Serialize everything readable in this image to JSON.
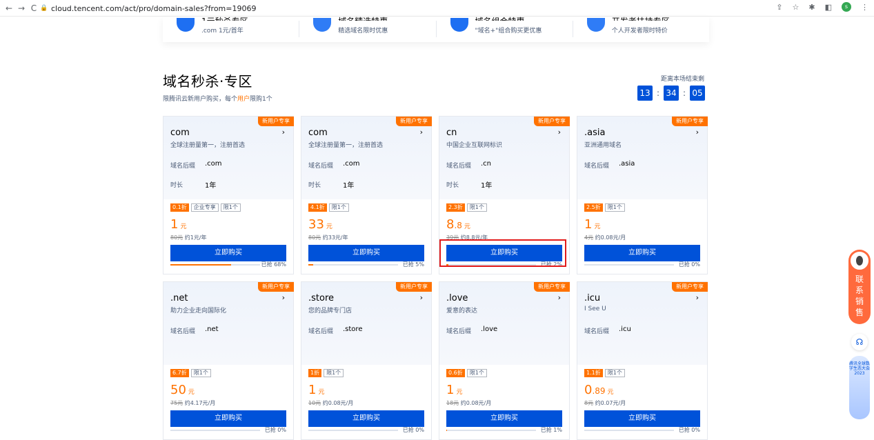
{
  "browser": {
    "url": "cloud.tencent.com/act/pro/domain-sales?from=19069",
    "back": "←",
    "forward": "→",
    "reload": "C",
    "profile": "s"
  },
  "top_strip": [
    {
      "title": "1元秒杀专区",
      "sub": ".com 1元/首年"
    },
    {
      "title": "域名精选特惠",
      "sub": "精选域名限时优惠"
    },
    {
      "title": "域名组合特惠",
      "sub": "\"域名+\"组合购买更优惠"
    },
    {
      "title": "开发者扶持专区",
      "sub": "个人开发者限时特价"
    }
  ],
  "section": {
    "title": "域名秒杀·专区",
    "sub_prefix": "限腾讯云新用户购买，每个",
    "sub_highlight": "用户",
    "sub_suffix": "限购1个",
    "countdown_label": "距离本场结束剩",
    "countdown": [
      "13",
      "34",
      "05"
    ],
    "countdown_sep": ":"
  },
  "labels": {
    "suffix": "域名后缀",
    "duration": "时长",
    "buy": "立即购买",
    "badge": "新用户专享",
    "chev": "›",
    "unit": "元"
  },
  "cards": [
    {
      "name": "com",
      "desc": "全球注册量第一，注册首选",
      "suffix": ".com",
      "duration": "1年",
      "tags": [
        "0.1折",
        "企业专享",
        "限1个"
      ],
      "price_int": "1",
      "price_dec": "",
      "orig_price": "80元",
      "orig_note": "约1元/年",
      "sold": 0.68,
      "sold_label": "已抢 68%"
    },
    {
      "name": "com",
      "desc": "全球注册量第一，注册首选",
      "suffix": ".com",
      "duration": "1年",
      "tags": [
        "4.1折",
        "限1个"
      ],
      "price_int": "33",
      "price_dec": "",
      "orig_price": "80元",
      "orig_note": "约33元/年",
      "sold": 0.05,
      "sold_label": "已抢 5%"
    },
    {
      "name": "cn",
      "desc": "中国企业互联网标识",
      "suffix": ".cn",
      "duration": "1年",
      "tags": [
        "2.3折",
        "限1个"
      ],
      "price_int": "8",
      "price_dec": ".8",
      "orig_price": "39元",
      "orig_note": "约8.8元/年",
      "sold": 0.02,
      "sold_label": "已抢 2%"
    },
    {
      "name": ".asia",
      "desc": "亚洲通用域名",
      "suffix": ".asia",
      "duration": "",
      "tags": [
        "2.5折",
        "限1个"
      ],
      "price_int": "1",
      "price_dec": "",
      "orig_price": "4元",
      "orig_note": "约0.08元/月",
      "sold": 0.0,
      "sold_label": "已抢 0%"
    },
    {
      "name": ".net",
      "desc": "助力企业走向国际化",
      "suffix": ".net",
      "duration": "",
      "tags": [
        "6.7折",
        "限1个"
      ],
      "price_int": "50",
      "price_dec": "",
      "orig_price": "75元",
      "orig_note": "约4.17元/月",
      "sold": 0.0,
      "sold_label": "已抢 0%"
    },
    {
      "name": ".store",
      "desc": "您的品牌专门店",
      "suffix": ".store",
      "duration": "",
      "tags": [
        "1折",
        "限1个"
      ],
      "price_int": "1",
      "price_dec": "",
      "orig_price": "10元",
      "orig_note": "约0.08元/月",
      "sold": 0.0,
      "sold_label": "已抢 0%"
    },
    {
      "name": ".love",
      "desc": "爱意的表达",
      "suffix": ".love",
      "duration": "",
      "tags": [
        "0.6折",
        "限1个"
      ],
      "price_int": "1",
      "price_dec": "",
      "orig_price": "18元",
      "orig_note": "约0.08元/月",
      "sold": 0.01,
      "sold_label": "已抢 1%"
    },
    {
      "name": ".icu",
      "desc": "I See U",
      "suffix": ".icu",
      "duration": "",
      "tags": [
        "1.1折",
        "限1个"
      ],
      "price_int": "0",
      "price_dec": ".89",
      "orig_price": "8元",
      "orig_note": "约0.07元/月",
      "sold": 0.0,
      "sold_label": "已抢 0%"
    }
  ],
  "side": {
    "sales": [
      "联",
      "系",
      "销",
      "售"
    ],
    "banner": "腾讯全球数字生态大会2023"
  },
  "colors": {
    "accent": "#0052d9",
    "orange": "#ff7200",
    "highlight": "#e21a1a"
  }
}
